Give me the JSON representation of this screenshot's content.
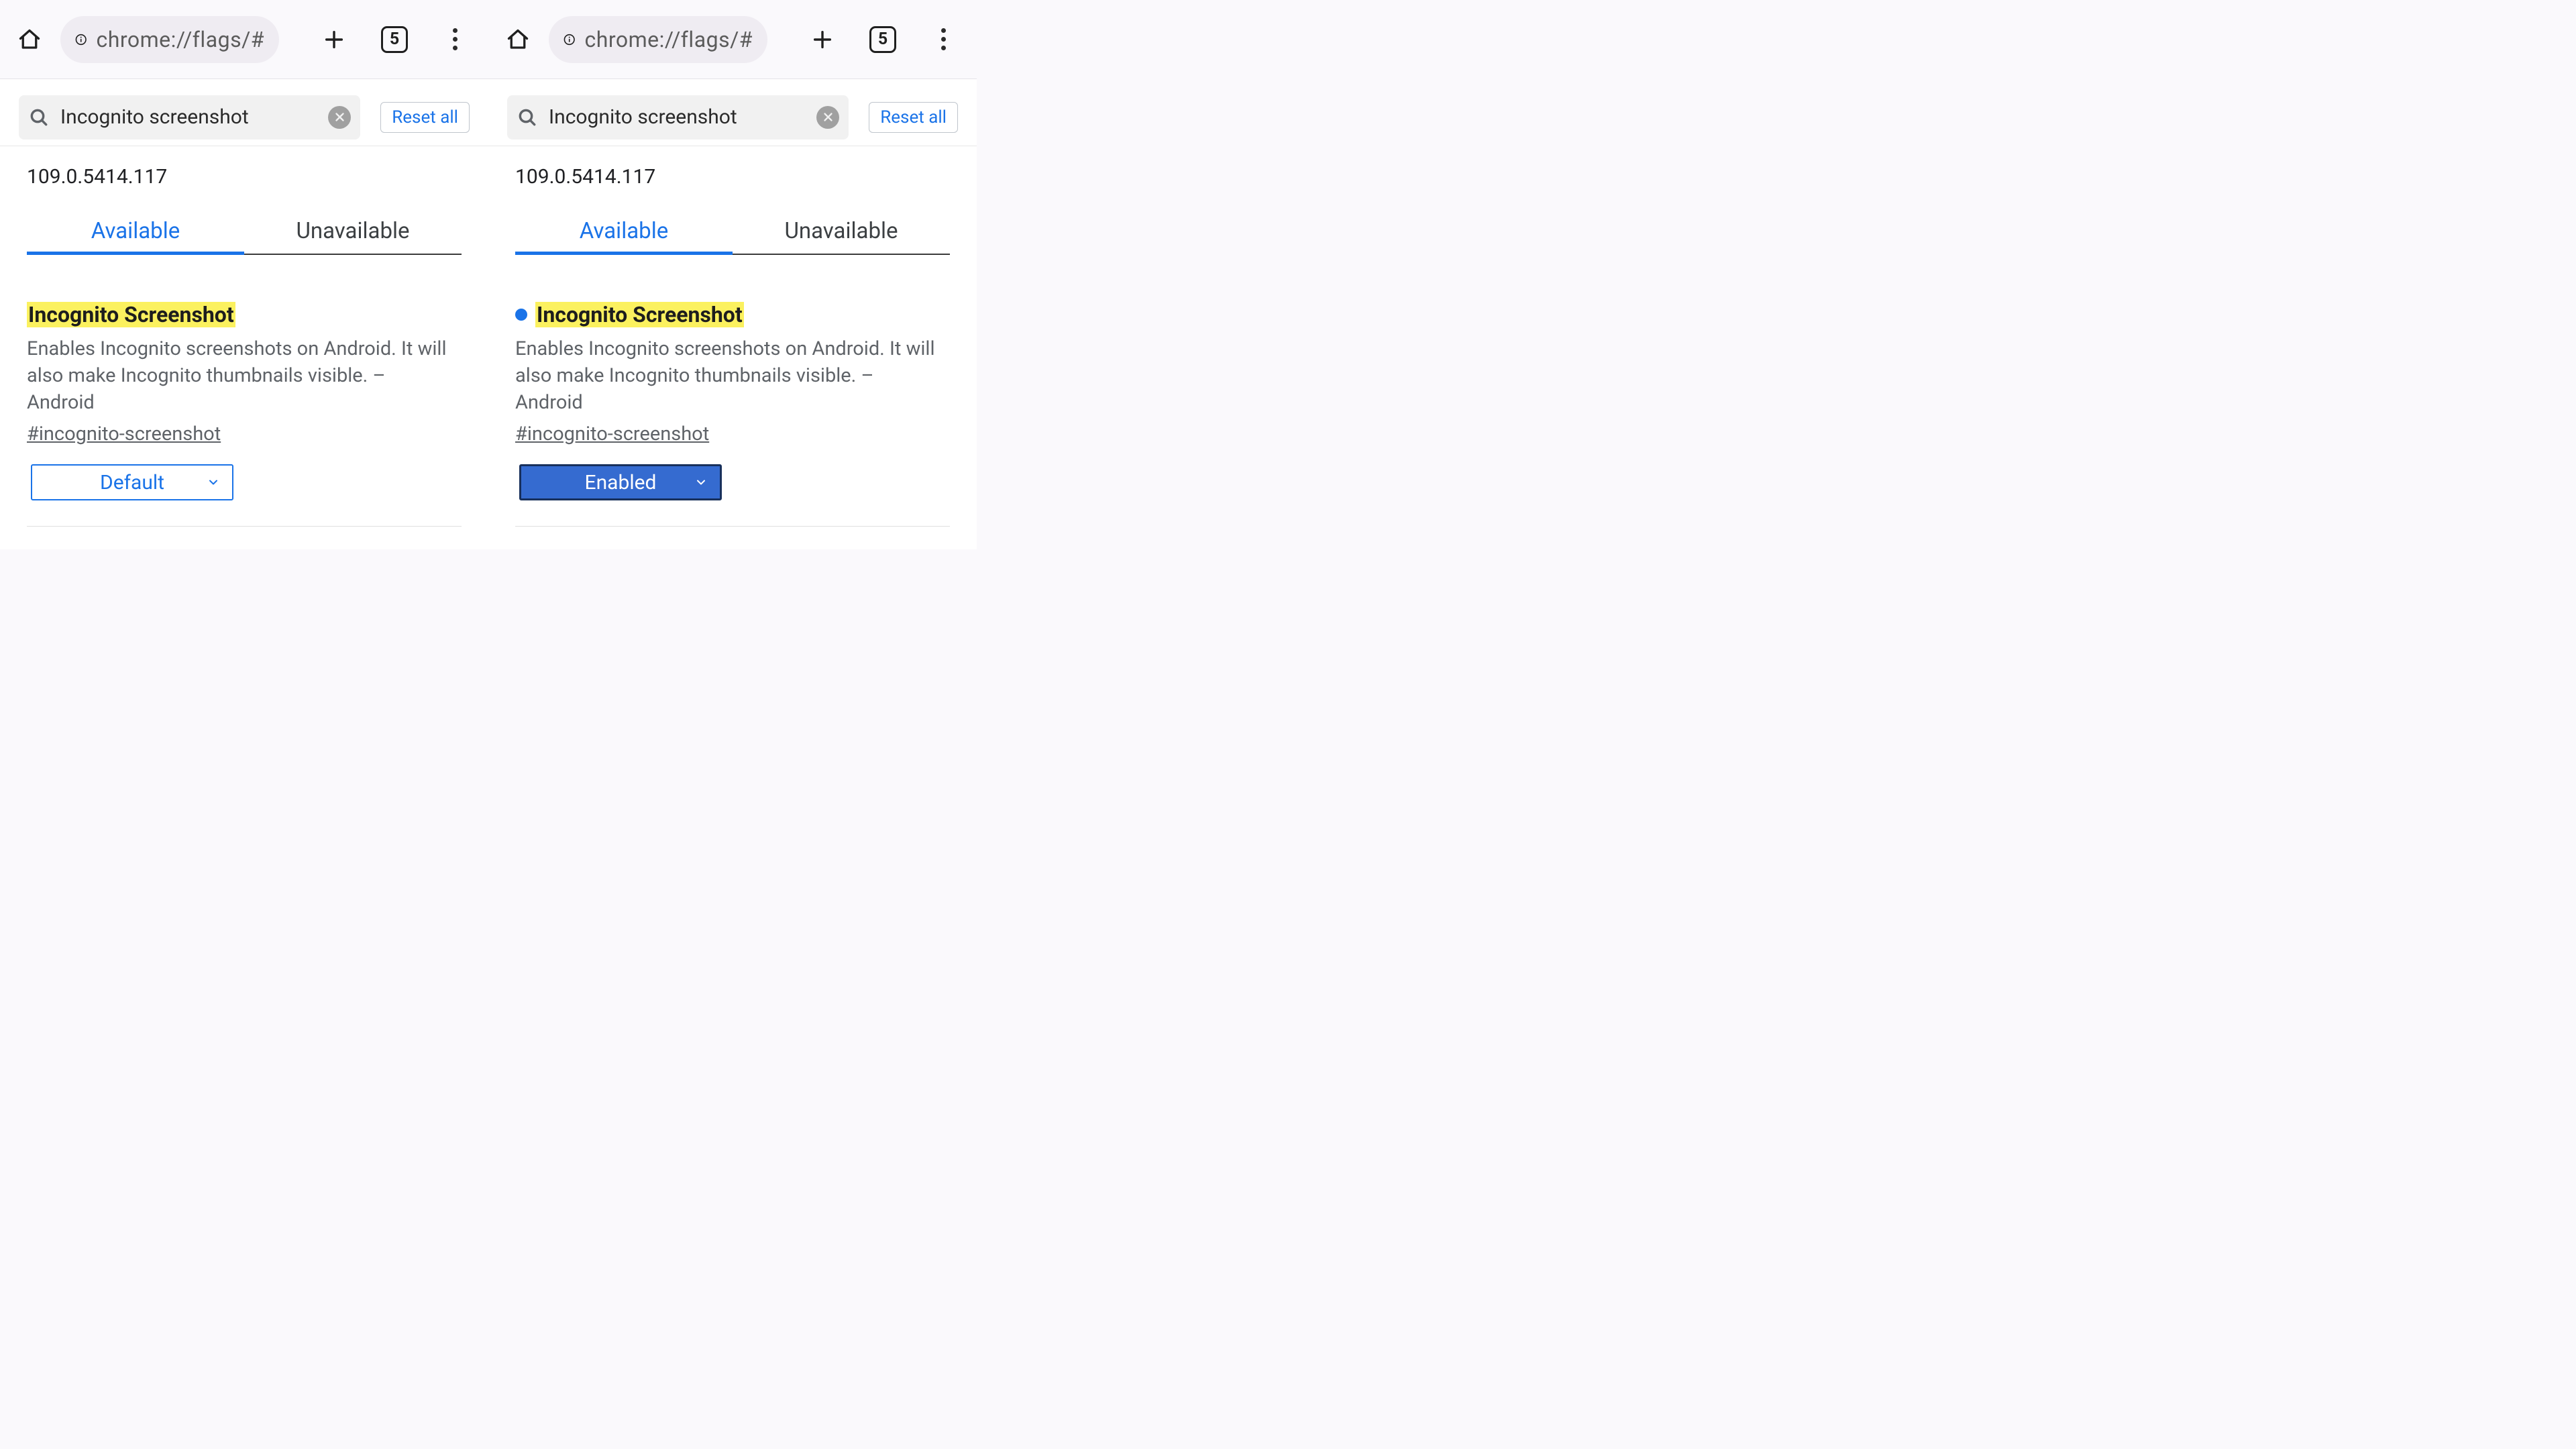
{
  "panes": [
    {
      "topbar": {
        "url": "chrome://flags/#",
        "tab_count": "5"
      },
      "search": {
        "query": "Incognito screenshot",
        "reset_label": "Reset all"
      },
      "version": "109.0.5414.117",
      "tabs": {
        "available": "Available",
        "unavailable": "Unavailable"
      },
      "flag": {
        "changed": false,
        "title": "Incognito Screenshot",
        "desc": "Enables Incognito screenshots on Android. It will also make Incognito thumbnails visible. – Android",
        "anchor": "#incognito-screenshot",
        "select_value": "Default",
        "select_style": "default"
      }
    },
    {
      "topbar": {
        "url": "chrome://flags/#",
        "tab_count": "5"
      },
      "search": {
        "query": "Incognito screenshot",
        "reset_label": "Reset all"
      },
      "version": "109.0.5414.117",
      "tabs": {
        "available": "Available",
        "unavailable": "Unavailable"
      },
      "flag": {
        "changed": true,
        "title": "Incognito Screenshot",
        "desc": "Enables Incognito screenshots on Android. It will also make Incognito thumbnails visible. – Android",
        "anchor": "#incognito-screenshot",
        "select_value": "Enabled",
        "select_style": "enabled"
      }
    }
  ]
}
